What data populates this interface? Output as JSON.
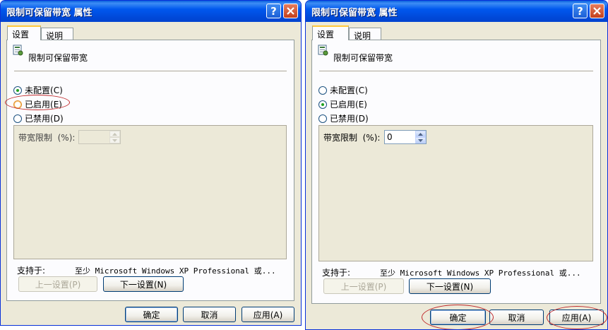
{
  "dialogs": [
    {
      "title": "限制可保留带宽 属性",
      "tabs": [
        "设置",
        "说明"
      ],
      "policy_name": "限制可保留带宽",
      "options": [
        "未配置",
        "已启用",
        "已禁用"
      ],
      "option_keys": [
        "(C)",
        "(E)",
        "(D)"
      ],
      "selected_option": "未配置",
      "bandwidth_label": "带宽限制  (%):",
      "bandwidth_value": "",
      "bandwidth_enabled": false,
      "supported_label": "支持于:",
      "supported_value": "至少 Microsoft Windows XP Professional 或...",
      "prev_button": "上一设置(P)",
      "next_button": "下一设置(N)",
      "ok_button": "确定",
      "cancel_button": "取消",
      "apply_button": "应用(A)"
    },
    {
      "title": "限制可保留带宽 属性",
      "tabs": [
        "设置",
        "说明"
      ],
      "policy_name": "限制可保留带宽",
      "options": [
        "未配置",
        "已启用",
        "已禁用"
      ],
      "option_keys": [
        "(C)",
        "(E)",
        "(D)"
      ],
      "selected_option": "已启用",
      "bandwidth_label": "带宽限制  (%):",
      "bandwidth_value": "0",
      "bandwidth_enabled": true,
      "supported_label": "支持于:",
      "supported_value": "至少 Microsoft Windows XP Professional 或...",
      "prev_button": "上一设置(P)",
      "next_button": "下一设置(N)",
      "ok_button": "确定",
      "cancel_button": "取消",
      "apply_button": "应用(A)"
    }
  ],
  "colors": {
    "titlebar": "#0058ee",
    "dialog_bg": "#ece9d8",
    "annotation": "#c0282a"
  },
  "icons": [
    "help-icon",
    "close-icon",
    "policy-icon",
    "spin-up-icon",
    "spin-down-icon"
  ]
}
